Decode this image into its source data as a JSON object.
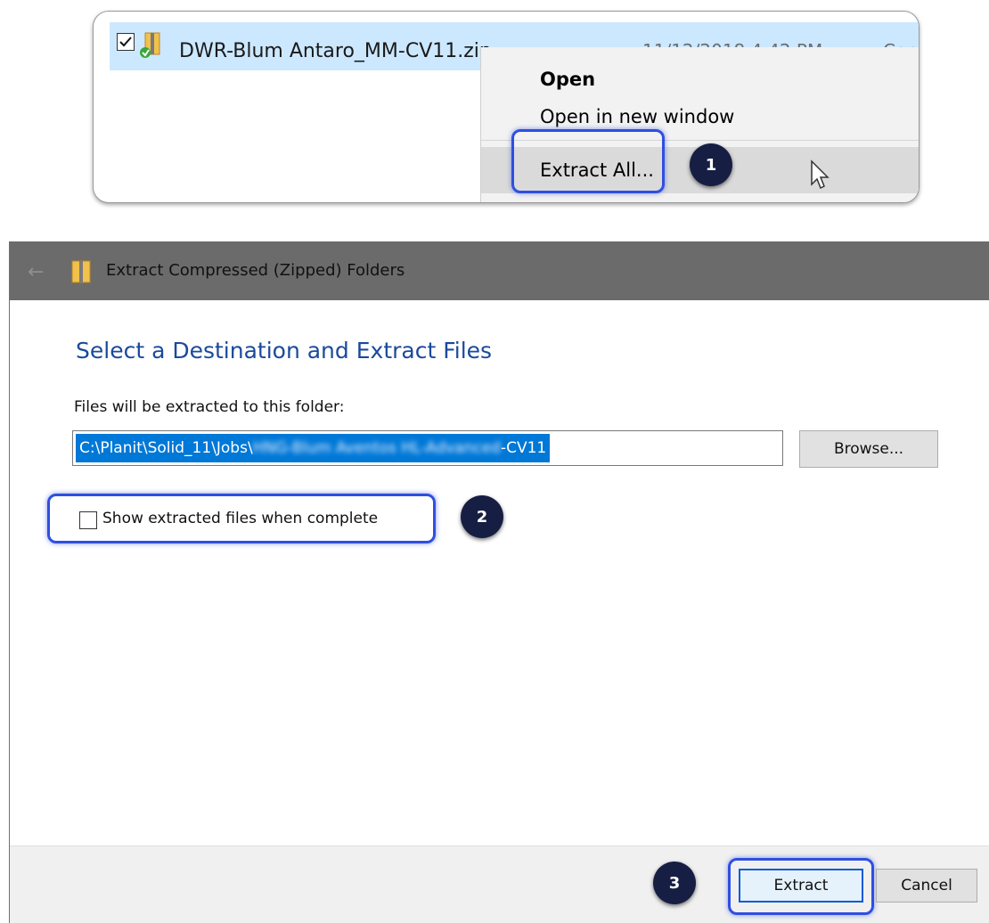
{
  "explorer": {
    "file": {
      "name": "DWR-Blum Antaro_MM-CV11.zip",
      "date": "11/12/2018 4:42 PM",
      "type": "Cor",
      "checked": true
    },
    "context_menu": {
      "open": "Open",
      "open_new_window": "Open in new window",
      "extract_all": "Extract All..."
    }
  },
  "steps": {
    "one": "1",
    "two": "2",
    "three": "3"
  },
  "dialog": {
    "title": "Extract Compressed (Zipped) Folders",
    "heading": "Select a Destination and Extract Files",
    "folder_label": "Files will be extracted to this folder:",
    "path_visible": "C:\\Planit\\Solid_11\\Jobs\\",
    "path_obscured": "HNG-Blum Aventos HL-Advanced",
    "path_end": "-CV11",
    "browse_label": "Browse...",
    "show_files_label": "Show extracted files when complete",
    "show_files_checked": false,
    "extract_label": "Extract",
    "cancel_label": "Cancel"
  },
  "colors": {
    "highlight": "#2f4fe0",
    "badge": "#161e43",
    "selection": "#0078d7",
    "heading": "#1a4a9c"
  }
}
